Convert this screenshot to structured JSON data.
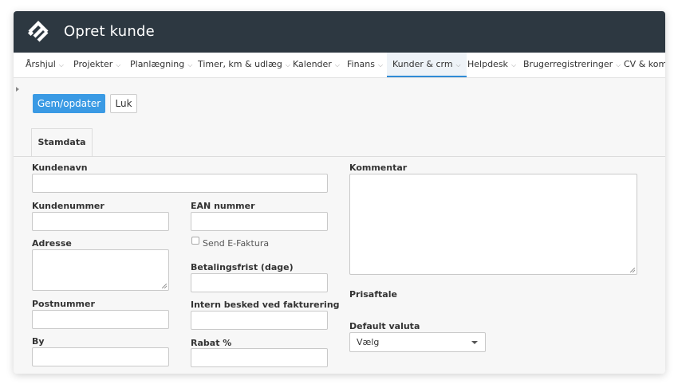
{
  "window": {
    "title": "Opret kunde"
  },
  "menu": {
    "items": [
      {
        "label": "Årshjul"
      },
      {
        "label": "Projekter"
      },
      {
        "label": "Planlægning"
      },
      {
        "label": "Timer, km & udlæg"
      },
      {
        "label": "Kalender"
      },
      {
        "label": "Finans"
      },
      {
        "label": "Kunder & crm",
        "active": true
      },
      {
        "label": "Helpdesk"
      },
      {
        "label": "Brugerregistreringer"
      },
      {
        "label": "CV & komp"
      }
    ]
  },
  "toolbar": {
    "save_label": "Gem/opdater",
    "close_label": "Luk"
  },
  "tabs": [
    {
      "label": "Stamdata"
    }
  ],
  "form": {
    "kundenavn": {
      "label": "Kundenavn",
      "value": ""
    },
    "kundenummer": {
      "label": "Kundenummer",
      "value": ""
    },
    "ean": {
      "label": "EAN nummer",
      "value": ""
    },
    "adresse": {
      "label": "Adresse",
      "value": ""
    },
    "send_efaktura": {
      "label": "Send E-Faktura",
      "checked": false
    },
    "betalingsfrist": {
      "label": "Betalingsfrist (dage)",
      "value": ""
    },
    "postnummer": {
      "label": "Postnummer",
      "value": ""
    },
    "intern_besked": {
      "label": "Intern besked ved fakturering",
      "value": ""
    },
    "by": {
      "label": "By",
      "value": ""
    },
    "rabat": {
      "label": "Rabat %",
      "value": ""
    },
    "kommentar": {
      "label": "Kommentar",
      "value": ""
    },
    "prisaftale": {
      "label": "Prisaftale"
    },
    "valuta": {
      "label": "Default valuta",
      "selected": "Vælg"
    }
  },
  "colors": {
    "titlebar": "#2d3841",
    "primary": "#3a9ae4",
    "active_tab_underline": "#2f8bd6"
  },
  "icons": {
    "logo": "app-logo-icon",
    "menu_chevron": "chevron-down-icon",
    "select_caret": "caret-down-icon"
  }
}
